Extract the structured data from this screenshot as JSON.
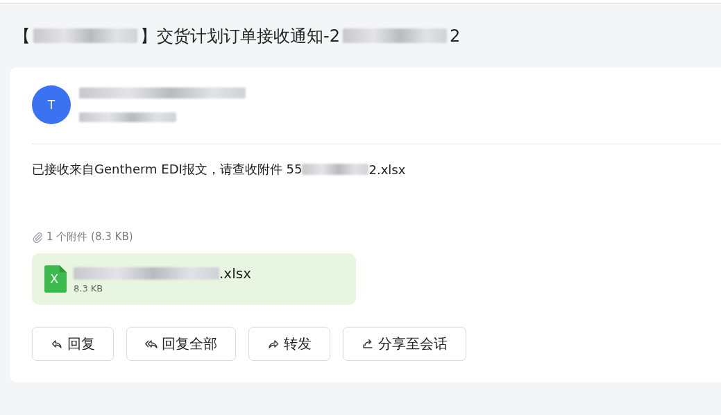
{
  "subject": [
    {
      "kind": "text",
      "text": "【"
    },
    {
      "kind": "redacted"
    },
    {
      "kind": "text",
      "text": "】交货计划订单接收通知-2"
    },
    {
      "kind": "redacted"
    },
    {
      "kind": "text",
      "text": "2"
    }
  ],
  "sender": {
    "avatar": "T",
    "name": [
      {
        "kind": "redacted"
      }
    ],
    "time": [
      {
        "kind": "redacted"
      }
    ]
  },
  "body": [
    {
      "kind": "text",
      "text": "已接收来自Gentherm EDI报文，请查收附件 55"
    },
    {
      "kind": "redacted"
    },
    {
      "kind": "text",
      "text": "2.xlsx"
    }
  ],
  "attachments_summary": "1 个附件 (8.3 KB)",
  "attachments": [
    {
      "icon": "X",
      "name": [
        {
          "kind": "redacted"
        },
        {
          "kind": "text",
          "text": ".xlsx"
        }
      ],
      "size": "8.3 KB"
    }
  ],
  "actions": [
    {
      "kind": "reply",
      "label": "回复"
    },
    {
      "kind": "reply_all",
      "label": "回复全部"
    },
    {
      "kind": "forward",
      "label": "转发"
    },
    {
      "kind": "share",
      "label": "分享至会话"
    }
  ]
}
